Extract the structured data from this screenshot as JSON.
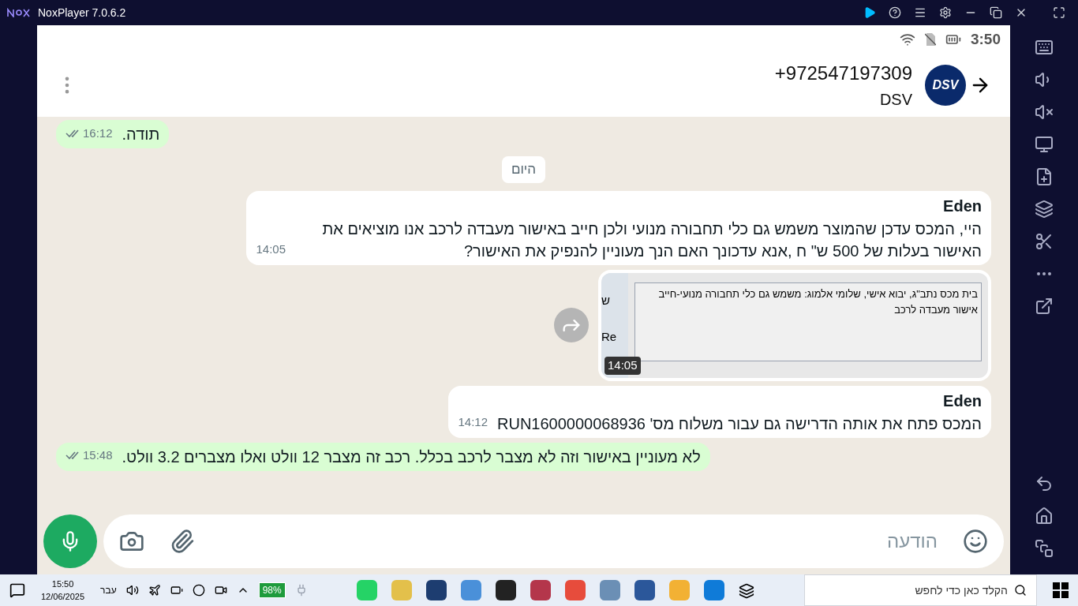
{
  "window": {
    "title": "NoxPlayer 7.0.6.2"
  },
  "status_bar": {
    "time": "3:50"
  },
  "header": {
    "phone": "+972547197309",
    "name": "DSV",
    "avatar_text": "DSV"
  },
  "messages": [
    {
      "kind": "text",
      "outgoing": true,
      "text": "תודה.",
      "time": "16:12"
    },
    {
      "kind": "date",
      "text": "היום"
    },
    {
      "kind": "text",
      "outgoing": false,
      "sender": "Eden",
      "text": "היי, המכס עדכן שהמוצר משמש גם כלי תחבורה מנועי  ולכן חייב באישור מעבדה לרכב אנו מוציאים את האישור בעלות של 500 ש\" ח ,אנא עדכונך האם הנך מעוניין להנפיק את האישור?",
      "time": "14:05"
    },
    {
      "kind": "image",
      "outgoing": false,
      "time": "14:05",
      "doc_text": "בית מכס נתב\"ג, יבוא אישי, שלומי אלמוג:  משמש גם כלי תחבורה מנועי-חייב אישור מעבדה לרכב",
      "side_texts": [
        "ש",
        "Re"
      ]
    },
    {
      "kind": "text",
      "outgoing": false,
      "sender": "Eden",
      "text": "המכס פתח את אותה הדרישה גם עבור משלוח מס' RUN1600000068936",
      "time": "14:12"
    },
    {
      "kind": "text",
      "outgoing": true,
      "text": "לא מעוניין באישור וזה לא מצבר לרכב בכלל. רכב זה מצבר 12 וולט ואלו מצברים 3.2 וולט.",
      "time": "15:48"
    }
  ],
  "composer": {
    "placeholder": "הודעה"
  },
  "taskbar": {
    "time": "15:50",
    "date": "12/06/2025",
    "language": "עבר",
    "battery": "98%",
    "search_placeholder": "הקלד כאן כדי לחפש"
  }
}
